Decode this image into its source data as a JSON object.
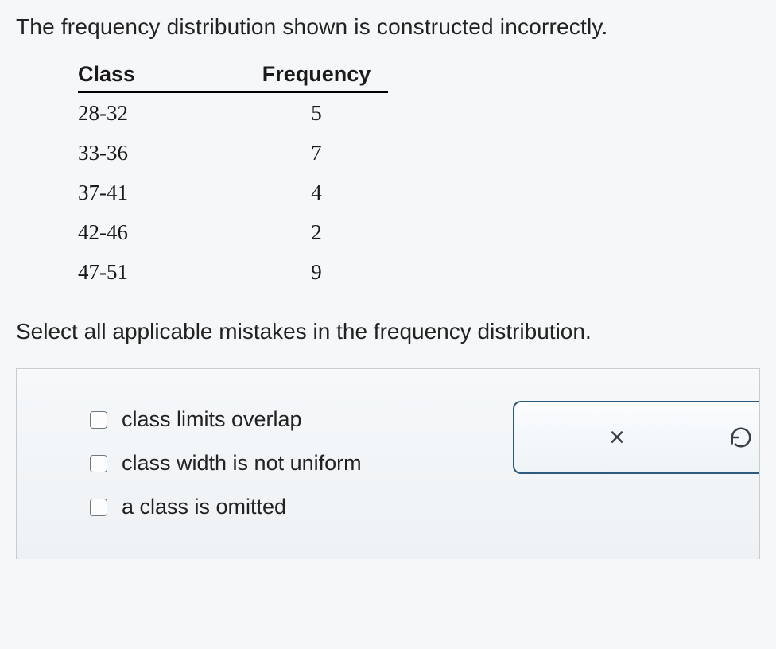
{
  "intro": "The frequency distribution shown is constructed incorrectly.",
  "table": {
    "header_class": "Class",
    "header_freq": "Frequency",
    "rows": [
      {
        "class": "28-32",
        "freq": "5"
      },
      {
        "class": "33-36",
        "freq": "7"
      },
      {
        "class": "37-41",
        "freq": "4"
      },
      {
        "class": "42-46",
        "freq": "2"
      },
      {
        "class": "47-51",
        "freq": "9"
      }
    ]
  },
  "instruction": "Select all applicable mistakes in the frequency distribution.",
  "options": {
    "opt1": "class limits overlap",
    "opt2": "class width is not uniform",
    "opt3": "a class is omitted"
  },
  "tools": {
    "close": "×"
  }
}
